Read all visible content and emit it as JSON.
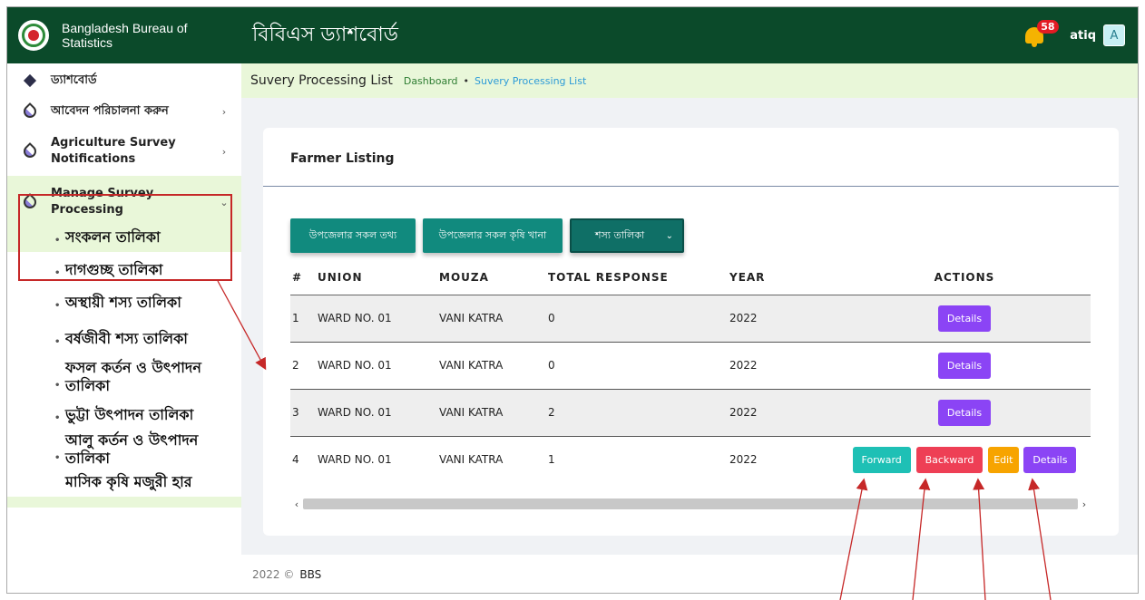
{
  "sidebar": {
    "brand_text": "Bangladesh Bureau of Statistics",
    "items": [
      {
        "label": "ড্যাশবোর্ড",
        "icon": "diamond-icon"
      },
      {
        "label": "আবেদন পরিচালনা করুন",
        "icon": "drop-icon",
        "chevron": "›"
      },
      {
        "label": "Agriculture Survey Notifications",
        "icon": "drop-icon",
        "chevron": "›"
      },
      {
        "label": "Manage Survey Processing",
        "icon": "drop-icon",
        "chevron": "⌄"
      }
    ],
    "subitems": [
      "সংকলন তালিকা",
      "দাগগুচ্ছ তালিকা",
      "অস্থায়ী শস্য তালিকা",
      "বর্ষজীবী শস্য তালিকা",
      "ফসল কর্তন ও উৎপাদন তালিকা",
      "ভুট্টা উৎপাদন তালিকা",
      "আলু কর্তন ও উৎপাদন তালিকা",
      "মাসিক কৃষি মজুরী হার"
    ]
  },
  "topbar": {
    "title": "বিবিএস ড্যাশবোর্ড",
    "notification_count": "58",
    "username": "atiq",
    "avatar_letter": "A"
  },
  "breadcrumb": {
    "title": "Suvery Processing List",
    "home": "Dashboard",
    "separator": "•",
    "current": "Suvery Processing List"
  },
  "card": {
    "title": "Farmer Listing",
    "buttons": [
      "উপজেলার সকল তথ্য",
      "উপজেলার সকল কৃষি খানা"
    ],
    "select": {
      "label": "শস্য তালিকা",
      "chevron": "⌄"
    },
    "table": {
      "headers": [
        "#",
        "UNION",
        "MOUZA",
        "TOTAL RESPONSE",
        "YEAR",
        "ACTIONS"
      ],
      "rows": [
        {
          "n": "1",
          "union": "WARD NO. 01",
          "mouza": "VANI KATRA",
          "total": "0",
          "year": "2022"
        },
        {
          "n": "2",
          "union": "WARD NO. 01",
          "mouza": "VANI KATRA",
          "total": "0",
          "year": "2022"
        },
        {
          "n": "3",
          "union": "WARD NO. 01",
          "mouza": "VANI KATRA",
          "total": "2",
          "year": "2022"
        },
        {
          "n": "4",
          "union": "WARD NO. 01",
          "mouza": "VANI KATRA",
          "total": "1",
          "year": "2022"
        }
      ],
      "action_labels": {
        "details": "Details",
        "forward": "Forward",
        "backward": "Backward",
        "edit": "Edit"
      }
    },
    "scroll": {
      "left": "‹",
      "right": "›"
    }
  },
  "footer": {
    "year": "2022 ©",
    "brand": "BBS"
  },
  "colors": {
    "header_green": "#0b4a2a",
    "active_bg": "#e9f7d9",
    "teal": "#118a7e",
    "details": "#8b44f5",
    "forward": "#1ec0b5",
    "backward": "#ee3f55",
    "edit": "#f7a400",
    "annotation": "#c62828"
  }
}
